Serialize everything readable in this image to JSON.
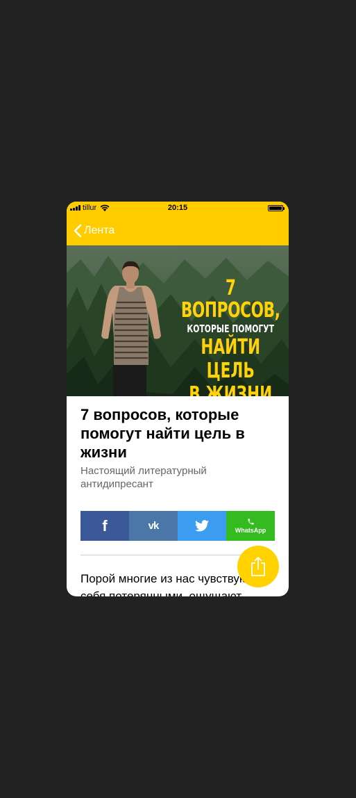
{
  "status_bar": {
    "carrier": "tillur",
    "time": "20:15"
  },
  "nav": {
    "back_label": "Лента"
  },
  "hero": {
    "line1": "7 ВОПРОСОВ,",
    "line2": "КОТОРЫЕ ПОМОГУТ",
    "line3": "НАЙТИ ЦЕЛЬ",
    "line4": "В ЖИЗНИ"
  },
  "article": {
    "title": "7 вопросов, которые помогут найти цель в жизни",
    "subtitle": "Настоящий литературный антидипресант",
    "body": "Порой многие из нас чувствуют себя потерянными, ощущают"
  },
  "share": {
    "facebook": "f",
    "vk": "vk",
    "twitter": "twitter",
    "whatsapp_label": "WhatsApp"
  },
  "colors": {
    "accent": "#ffcc00",
    "fab": "#ffd200",
    "facebook": "#3b5998",
    "vk": "#4a76a8",
    "twitter": "#3b9cf0",
    "whatsapp": "#33bb1f"
  },
  "icons": [
    "signal-icon",
    "wifi-icon",
    "battery-icon",
    "chevron-left-icon",
    "facebook-icon",
    "vk-icon",
    "twitter-icon",
    "whatsapp-icon",
    "share-icon"
  ]
}
